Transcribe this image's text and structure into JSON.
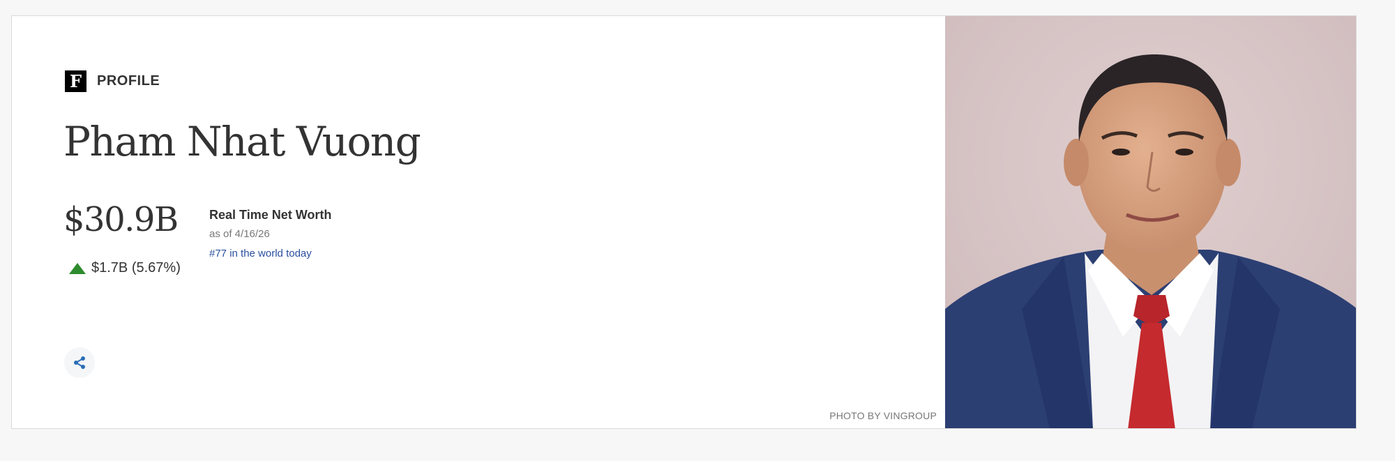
{
  "profile": {
    "logo_letter": "F",
    "section_label": "PROFILE",
    "name": "Pham Nhat Vuong",
    "net_worth": "$30.9B",
    "change_text": "$1.7B (5.67%)",
    "change_direction": "up",
    "change_color": "#2e8b2e",
    "real_time_label": "Real Time Net Worth",
    "as_of": "as of 4/16/26",
    "rank_link": "#77 in the world today",
    "share_icon": "share-icon",
    "photo_credit": "PHOTO BY VINGROUP"
  },
  "colors": {
    "link": "#2a4f9e",
    "share_icon": "#2a6db5",
    "photo_background": "#d8c5c6",
    "suit": "#2c3f73",
    "tie": "#c52a2e"
  }
}
